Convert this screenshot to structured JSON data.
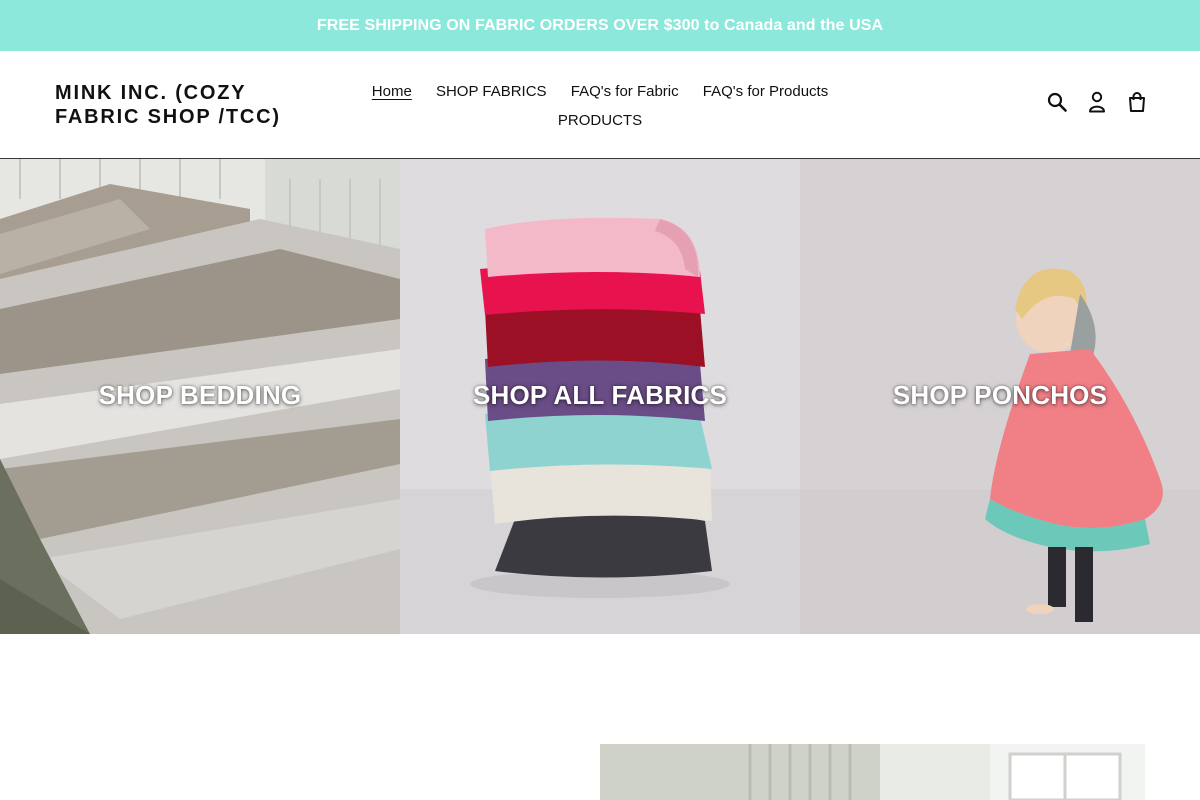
{
  "announcement": "FREE SHIPPING ON FABRIC ORDERS OVER $300 to Canada and the USA",
  "header": {
    "logo": "MINK INC. (COZY FABRIC SHOP /TCC)",
    "nav": [
      {
        "label": "Home",
        "active": true
      },
      {
        "label": "SHOP FABRICS",
        "active": false
      },
      {
        "label": "FAQ's for Fabric",
        "active": false
      },
      {
        "label": "FAQ's for Products",
        "active": false
      },
      {
        "label": "PRODUCTS",
        "active": false
      }
    ],
    "icons": [
      "search-icon",
      "account-icon",
      "cart-icon"
    ]
  },
  "collections": [
    {
      "label": "SHOP BEDDING",
      "image": "bedding-photo"
    },
    {
      "label": "SHOP ALL FABRICS",
      "image": "fabric-stack-photo"
    },
    {
      "label": "SHOP PONCHOS",
      "image": "poncho-child-photo"
    }
  ],
  "colors": {
    "announcement_bg": "#8de8dc",
    "announcement_text": "#ffffff",
    "text": "#111111"
  }
}
